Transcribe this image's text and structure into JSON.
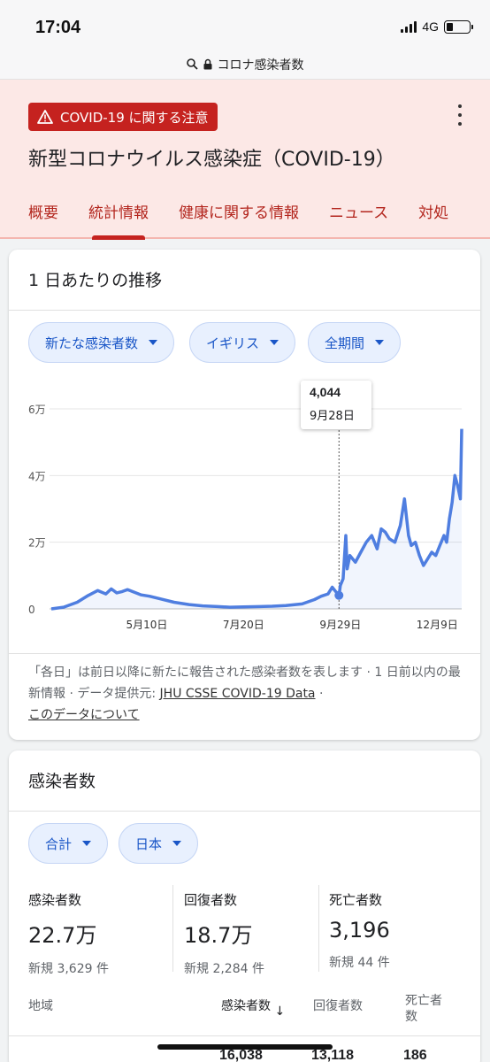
{
  "status_bar": {
    "time": "17:04",
    "network": "4G"
  },
  "url_bar": {
    "text": "コロナ感染者数"
  },
  "header": {
    "warning": "COVID-19 に関する注意",
    "title": "新型コロナウイルス感染症（COVID-19）",
    "tabs": [
      {
        "label": "概要"
      },
      {
        "label": "統計情報",
        "active": true
      },
      {
        "label": "健康に関する情報"
      },
      {
        "label": "ニュース"
      },
      {
        "label": "対処"
      }
    ]
  },
  "trend_card": {
    "title": "1 日あたりの推移",
    "filters": {
      "metric": "新たな感染者数",
      "region": "イギリス",
      "period": "全期間"
    },
    "tooltip": {
      "value": "4,044",
      "date": "9月28日"
    },
    "note": {
      "text": "「各日」は前日以降に新たに報告された感染者数を表します · 1 日前以内の最新情報 · データ提供元:",
      "source_link": "JHU CSSE COVID-19 Data",
      "about_link": "このデータについて"
    }
  },
  "chart_data": {
    "type": "area",
    "y_tick_labels": [
      "0",
      "2万",
      "4万",
      "6万"
    ],
    "y_ticks": [
      0,
      20000,
      40000,
      60000
    ],
    "ylim": [
      0,
      60000
    ],
    "x_tick_labels": [
      "5月10日",
      "7月20日",
      "9月29日",
      "12月9日"
    ],
    "xlim": [
      "2020-03-01",
      "2020-12-27"
    ],
    "x_ticks": [
      "2020-05-10",
      "2020-07-20",
      "2020-09-29",
      "2020-12-09"
    ],
    "grid": true,
    "color": "#4f7ee0",
    "highlight": {
      "x": "2020-09-28",
      "y": 4044
    },
    "series": [
      {
        "x": [
          "2020-03-01",
          "2020-03-10",
          "2020-03-20",
          "2020-03-28",
          "2020-04-04",
          "2020-04-10",
          "2020-04-14",
          "2020-04-18",
          "2020-04-22",
          "2020-04-26",
          "2020-05-01",
          "2020-05-06",
          "2020-05-12",
          "2020-05-20",
          "2020-05-30",
          "2020-06-10",
          "2020-06-20",
          "2020-07-01",
          "2020-07-10",
          "2020-07-20",
          "2020-08-01",
          "2020-08-10",
          "2020-08-20",
          "2020-09-01",
          "2020-09-10",
          "2020-09-15",
          "2020-09-20",
          "2020-09-23",
          "2020-09-26",
          "2020-09-28",
          "2020-09-29",
          "2020-10-01",
          "2020-10-03",
          "2020-10-04",
          "2020-10-06",
          "2020-10-08",
          "2020-10-10",
          "2020-10-14",
          "2020-10-18",
          "2020-10-22",
          "2020-10-26",
          "2020-10-29",
          "2020-11-01",
          "2020-11-04",
          "2020-11-08",
          "2020-11-12",
          "2020-11-15",
          "2020-11-18",
          "2020-11-20",
          "2020-11-23",
          "2020-11-26",
          "2020-11-29",
          "2020-12-02",
          "2020-12-05",
          "2020-12-08",
          "2020-12-11",
          "2020-12-14",
          "2020-12-16",
          "2020-12-18",
          "2020-12-20",
          "2020-12-22",
          "2020-12-24",
          "2020-12-26",
          "2020-12-27"
        ],
        "y": [
          0,
          500,
          2000,
          4000,
          5500,
          4500,
          6000,
          4800,
          5200,
          5800,
          5000,
          4200,
          3800,
          3000,
          2000,
          1300,
          900,
          700,
          500,
          600,
          700,
          800,
          1000,
          1500,
          2800,
          3800,
          4500,
          6500,
          5000,
          4044,
          7000,
          9000,
          22000,
          12000,
          16000,
          15000,
          14000,
          17000,
          20000,
          22000,
          18000,
          24000,
          23000,
          21000,
          20000,
          25000,
          33000,
          22000,
          19000,
          20000,
          16000,
          13000,
          15000,
          17000,
          16000,
          19000,
          22000,
          20000,
          27000,
          32000,
          40000,
          37000,
          33000,
          54000
        ]
      }
    ]
  },
  "cases_card": {
    "title": "感染者数",
    "filters": {
      "scope": "合計",
      "country": "日本"
    },
    "stats": [
      {
        "label": "感染者数",
        "value": "22.7万",
        "new": "新規 3,629 件"
      },
      {
        "label": "回復者数",
        "value": "18.7万",
        "new": "新規 2,284 件"
      },
      {
        "label": "死亡者数",
        "value": "3,196",
        "new": "新規 44 件"
      }
    ],
    "table": {
      "headers": {
        "region": "地域",
        "cases": "感染者数",
        "sort_indicator": "↓",
        "recovered": "回復者数",
        "deaths_line1": "死亡者",
        "deaths_line2": "数"
      },
      "first_row": {
        "cases": "16,038",
        "recovered": "13,118",
        "deaths": "186"
      }
    }
  }
}
